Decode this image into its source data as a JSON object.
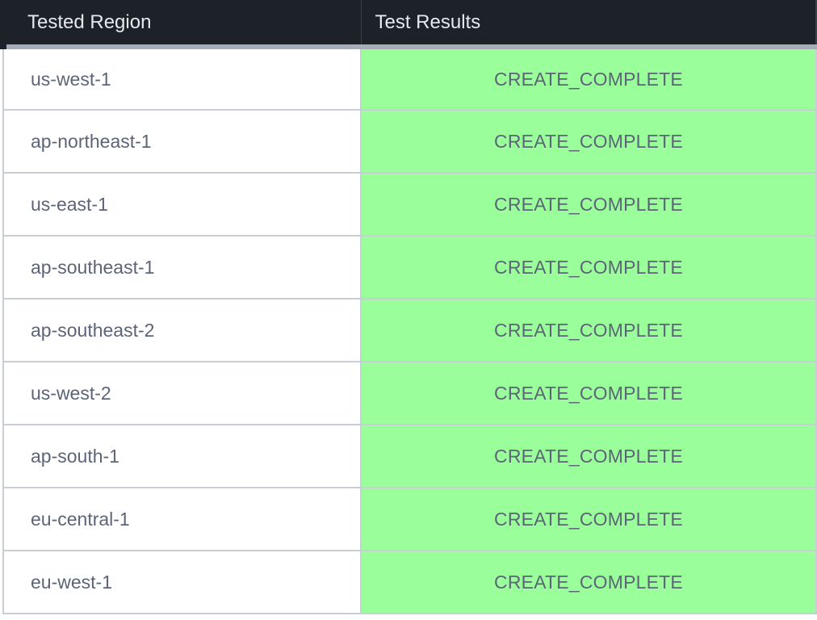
{
  "table": {
    "headers": {
      "region": "Tested Region",
      "results": "Test Results"
    },
    "rows": [
      {
        "region": "us-west-1",
        "result": "CREATE_COMPLETE"
      },
      {
        "region": "ap-northeast-1",
        "result": "CREATE_COMPLETE"
      },
      {
        "region": "us-east-1",
        "result": "CREATE_COMPLETE"
      },
      {
        "region": "ap-southeast-1",
        "result": "CREATE_COMPLETE"
      },
      {
        "region": "ap-southeast-2",
        "result": "CREATE_COMPLETE"
      },
      {
        "region": "us-west-2",
        "result": "CREATE_COMPLETE"
      },
      {
        "region": "ap-south-1",
        "result": "CREATE_COMPLETE"
      },
      {
        "region": "eu-central-1",
        "result": "CREATE_COMPLETE"
      },
      {
        "region": "eu-west-1",
        "result": "CREATE_COMPLETE"
      }
    ]
  },
  "colors": {
    "header_background": "#1d2128",
    "header_text": "#e7e9ee",
    "success_background": "#9aff9a",
    "cell_text": "#5c6478",
    "grid_line": "#c9cdd6"
  }
}
